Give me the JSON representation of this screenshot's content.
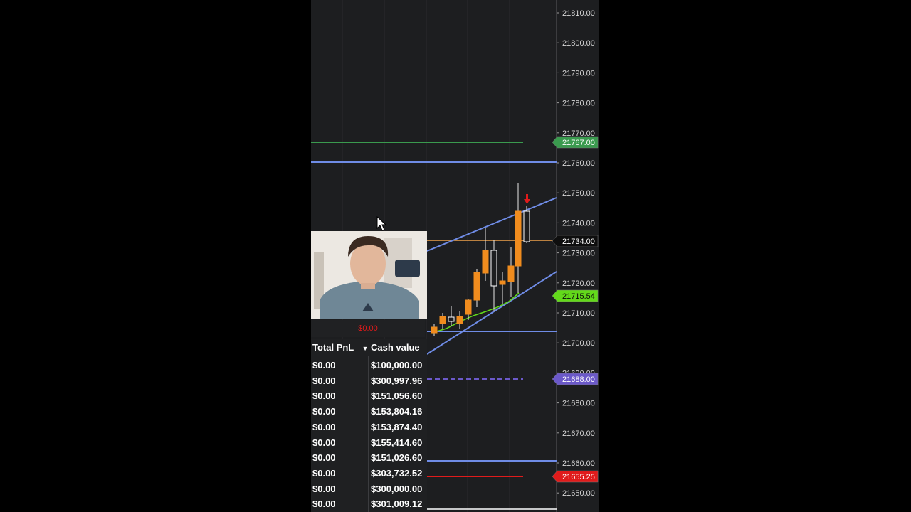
{
  "price_axis": {
    "ticks": [
      "21810.00",
      "21800.00",
      "21790.00",
      "21780.00",
      "21770.00",
      "21760.00",
      "21750.00",
      "21740.00",
      "21730.00",
      "21720.00",
      "21710.00",
      "21700.00",
      "21690.00",
      "21680.00",
      "21670.00",
      "21660.00",
      "21650.00"
    ],
    "tags": [
      {
        "label": "21767.00",
        "bg": "#3a9a4e",
        "fg": "#ffffff"
      },
      {
        "label": "21734.00",
        "bg": "#0e0e0e",
        "fg": "#ffffff"
      },
      {
        "label": "21715.54",
        "bg": "#62d91a",
        "fg": "#0c0c0c"
      },
      {
        "label": "21688.00",
        "bg": "#6b59c9",
        "fg": "#ffffff"
      },
      {
        "label": "21655.25",
        "bg": "#e01b1b",
        "fg": "#ffffff"
      }
    ]
  },
  "webcam": {
    "pnl": "$0.00"
  },
  "accounts": {
    "headers": {
      "total_pnl": "Total PnL",
      "cash_value": "Cash value",
      "sort_icon": "caret-down-icon"
    },
    "rows": [
      {
        "pnl": "$0.00",
        "cash": "$100,000.00"
      },
      {
        "pnl": "$0.00",
        "cash": "$300,997.96"
      },
      {
        "pnl": "$0.00",
        "cash": "$151,056.60"
      },
      {
        "pnl": "$0.00",
        "cash": "$153,804.16"
      },
      {
        "pnl": "$0.00",
        "cash": "$153,874.40"
      },
      {
        "pnl": "$0.00",
        "cash": "$155,414.60"
      },
      {
        "pnl": "$0.00",
        "cash": "$151,026.60"
      },
      {
        "pnl": "$0.00",
        "cash": "$303,732.52"
      },
      {
        "pnl": "$0.00",
        "cash": "$300,000.00"
      },
      {
        "pnl": "$0.00",
        "cash": "$301,009.12"
      }
    ]
  },
  "colors": {
    "bull_candle": "#f08c1e",
    "bear_candle": "#ffffff",
    "channel_line": "#6f8ce6",
    "ema_line": "#62d91a",
    "target_line": "#3a9a4e",
    "stop_line": "#e01b1b",
    "entry_line": "#6b59c9",
    "current_price_line": "#f0a24a"
  },
  "icons": {
    "mouse_cursor": "arrow-cursor-icon",
    "signal": "red-down-arrow-icon"
  }
}
